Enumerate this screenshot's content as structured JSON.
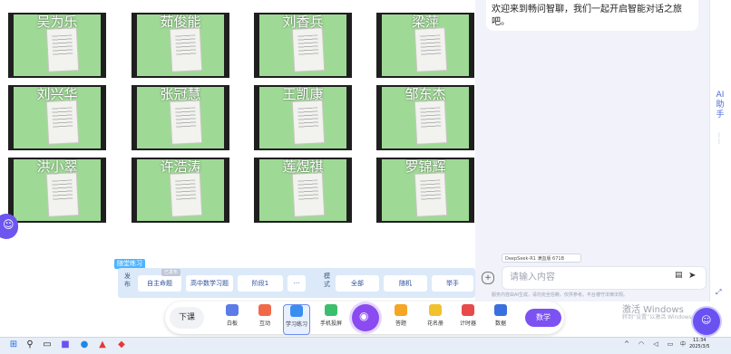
{
  "students": [
    {
      "name": "吴为乐"
    },
    {
      "name": "茹俊能"
    },
    {
      "name": "刘香兵"
    },
    {
      "name": "梁萍"
    },
    {
      "name": "刘兴华"
    },
    {
      "name": "张冠慧"
    },
    {
      "name": "王凯康"
    },
    {
      "name": "邹东杰"
    },
    {
      "name": "洪小翠"
    },
    {
      "name": "许浩涛"
    },
    {
      "name": "莲煜祺"
    },
    {
      "name": "罗锦辉"
    }
  ],
  "ai_panel": {
    "welcome": "欢迎来到畅问智聊，我们一起开启智能对话之旅吧。",
    "model": "DeepSeek-R1 满血版 671B",
    "input_placeholder": "请输入内容",
    "disclaimer": "服务内容由AI生成，请勿完全信赖，仅供参考。平台遵守法律法规。",
    "side_label": "AI助手"
  },
  "practice": {
    "tag": "随堂练习",
    "col_label": "发布",
    "badge": "已发布",
    "buttons": [
      "自主命题",
      "高中数学习题",
      "阶段1",
      "···"
    ],
    "mode_label": "模式",
    "modes": [
      "全部",
      "随机",
      "举手"
    ]
  },
  "toolbar": {
    "xiake": "下课",
    "tools": [
      "白板",
      "互动",
      "学习练习",
      "手机投屏",
      "拍照",
      "答题",
      "花名册",
      "计时器",
      "数据"
    ],
    "shuxue": "数学"
  },
  "watermark": {
    "line1": "激活 Windows",
    "line2": "转到“设置”以激活 Windows。"
  },
  "taskbar": {
    "time": "11:34",
    "date": "2025/3/5"
  },
  "colors": {
    "accent": "#7c52f2",
    "tile_paper_bg": "#9fd996",
    "practice_bg": "#dce9f9"
  }
}
